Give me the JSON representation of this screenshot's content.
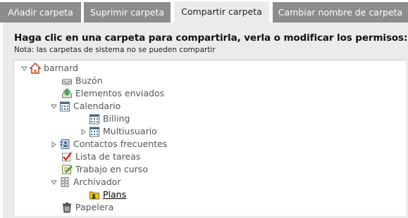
{
  "tabs": [
    {
      "label": "Añadir carpeta"
    },
    {
      "label": "Suprimir carpeta"
    },
    {
      "label": "Compartir carpeta",
      "active": true
    },
    {
      "label": "Cambiar nombre de carpeta"
    }
  ],
  "panel": {
    "heading": "Haga clic en una carpeta para compartirla, verla o modificar los permisos:",
    "note": "Nota: las carpetas de sistema no se pueden compartir"
  },
  "tree": {
    "root": {
      "label": "barnard",
      "icon": "home-icon",
      "expanded": true
    },
    "items": [
      {
        "label": "Buzón",
        "icon": "inbox-icon"
      },
      {
        "label": "Elementos enviados",
        "icon": "sent-items-icon"
      },
      {
        "label": "Calendario",
        "icon": "calendar-icon",
        "expanded": true
      },
      {
        "label": "Billing",
        "icon": "calendar-icon"
      },
      {
        "label": "Multiusuario",
        "icon": "calendar-icon",
        "expanded": false
      },
      {
        "label": "Contactos frecuentes",
        "icon": "address-book-icon",
        "expanded": false
      },
      {
        "label": "Lista de tareas",
        "icon": "checkmark-icon"
      },
      {
        "label": "Trabajo en curso",
        "icon": "edit-note-icon"
      },
      {
        "label": "Archivador",
        "icon": "cabinet-icon",
        "expanded": true
      },
      {
        "label": "Plans",
        "icon": "shared-folder-icon",
        "selected": true
      },
      {
        "label": "Papelera",
        "icon": "trash-icon"
      }
    ]
  },
  "colors": {
    "tab_inactive": "#8c8c8c",
    "tab_active": "#ebebeb",
    "panel_bg": "#ebebeb",
    "tree_bg": "#ffffff"
  }
}
